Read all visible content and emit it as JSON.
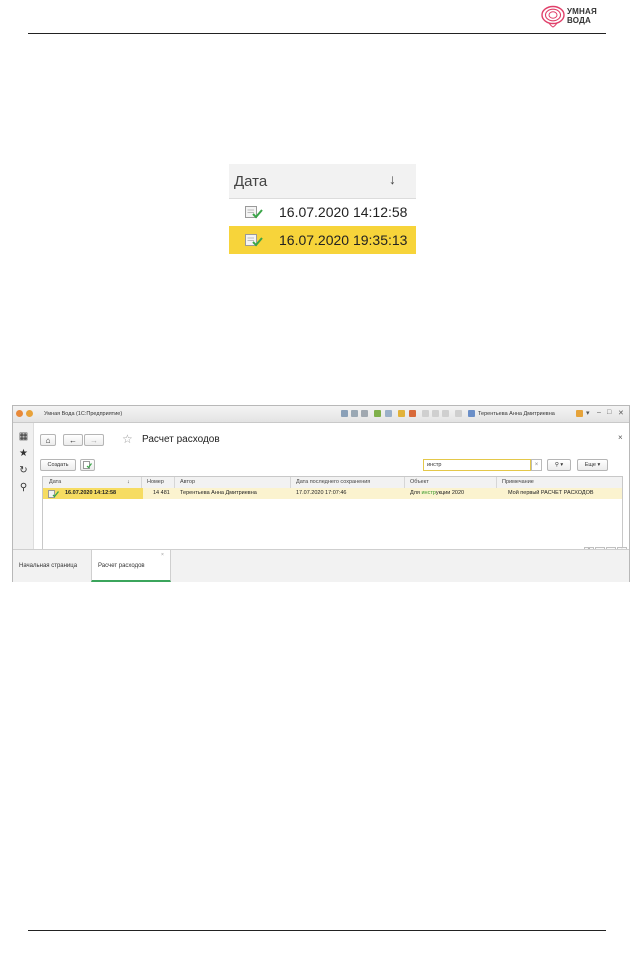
{
  "header": {
    "logo_line1": "УМНАЯ",
    "logo_line2": "ВОДА"
  },
  "zoom": {
    "column_label": "Дата",
    "sort_arrow": "↓",
    "rows": [
      {
        "date": "16.07.2020 14:12:58",
        "selected": false
      },
      {
        "date": "16.07.2020 19:35:13",
        "selected": true
      }
    ]
  },
  "window": {
    "title": "Умная Вода  (1С:Предприятие)",
    "user": "Терентьева Анна Дмитриевна",
    "form_title": "Расчет расходов",
    "create_button": "Создать",
    "search_value": "инстр",
    "search_clear": "×",
    "search_button_arrow": "▾",
    "more_button": "Еще",
    "columns": [
      "Дата",
      "Номер",
      "Автор",
      "Дата последнего сохранения",
      "Объект",
      "Примечание"
    ],
    "sort_arrow": "↓",
    "row": {
      "date": "16.07.2020 14:12:58",
      "number": "14 481",
      "author": "Терентьева Анна Дмитриевна",
      "saved": "17.07.2020 17:07:46",
      "object_pre": "Для ",
      "object_hl": "инстр",
      "object_post": "укции 2020",
      "note": "Мой первый РАСЧЕТ РАСХОДОВ"
    },
    "tabs": [
      "Начальная страница",
      "Расчет расходов"
    ],
    "tab_close": "×"
  },
  "colors": {
    "selection": "#f7d43a",
    "row_highlight": "#fbf3cf",
    "active_tab_accent": "#3ba55c",
    "search_match": "#3a9a2a"
  }
}
